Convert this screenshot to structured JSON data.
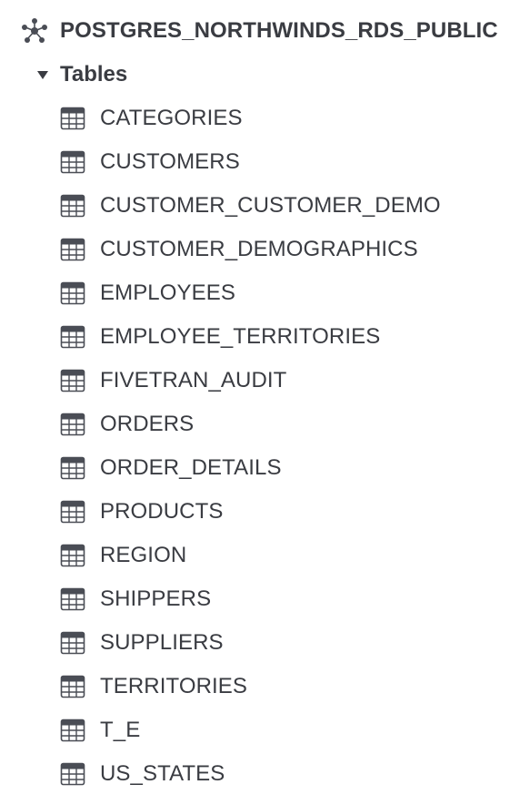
{
  "schema": {
    "label": "POSTGRES_NORTHWINDS_RDS_PUBLIC",
    "icon": "schema-network-icon"
  },
  "folder": {
    "label": "Tables",
    "expanded": true,
    "icon": "caret-down-icon"
  },
  "tables": [
    {
      "label": "CATEGORIES",
      "icon": "table-icon"
    },
    {
      "label": "CUSTOMERS",
      "icon": "table-icon"
    },
    {
      "label": "CUSTOMER_CUSTOMER_DEMO",
      "icon": "table-icon"
    },
    {
      "label": "CUSTOMER_DEMOGRAPHICS",
      "icon": "table-icon"
    },
    {
      "label": "EMPLOYEES",
      "icon": "table-icon"
    },
    {
      "label": "EMPLOYEE_TERRITORIES",
      "icon": "table-icon"
    },
    {
      "label": "FIVETRAN_AUDIT",
      "icon": "table-icon"
    },
    {
      "label": "ORDERS",
      "icon": "table-icon"
    },
    {
      "label": "ORDER_DETAILS",
      "icon": "table-icon"
    },
    {
      "label": "PRODUCTS",
      "icon": "table-icon"
    },
    {
      "label": "REGION",
      "icon": "table-icon"
    },
    {
      "label": "SHIPPERS",
      "icon": "table-icon"
    },
    {
      "label": "SUPPLIERS",
      "icon": "table-icon"
    },
    {
      "label": "TERRITORIES",
      "icon": "table-icon"
    },
    {
      "label": "T_E",
      "icon": "table-icon"
    },
    {
      "label": "US_STATES",
      "icon": "table-icon"
    }
  ],
  "colors": {
    "text": "#3a3c42",
    "icon": "#4a4d55",
    "background": "#ffffff"
  }
}
